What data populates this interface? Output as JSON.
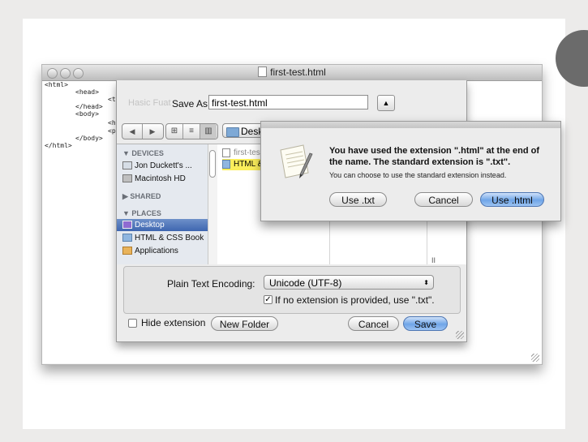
{
  "editor": {
    "title": "first-test.html",
    "code_lines": [
      "<html>",
      "<head>",
      "<t",
      "</head>",
      "<body>",
      "<h",
      "<p",
      "</body>",
      "</html>"
    ]
  },
  "save_dialog": {
    "faint_label": "Hasic Fuat",
    "save_as_label": "Save As:",
    "filename": "first-test.html",
    "expand_symbol": "▲",
    "nav_back": "◀",
    "nav_forward": "▶",
    "view_icon": "⊞",
    "view_list": "≡",
    "view_columns": "▥",
    "location": "Desktop",
    "sidebar": {
      "devices_header": "▼ DEVICES",
      "devices": [
        "Jon Duckett's ...",
        "Macintosh HD"
      ],
      "shared_header": "▶ SHARED",
      "places_header": "▼ PLACES",
      "places": [
        "Desktop",
        "HTML & CSS Book",
        "Applications"
      ]
    },
    "files": [
      "first-test.html",
      "HTML & CSS"
    ],
    "column_handle": "II",
    "encoding_label": "Plain Text Encoding:",
    "encoding_value": "Unicode (UTF-8)",
    "encoding_arrows": "⬍",
    "ext_checkbox_checked": "✓",
    "ext_checkbox_label": "If no extension is provided, use \".txt\".",
    "hide_extension_label": "Hide extension",
    "new_folder": "New Folder",
    "cancel": "Cancel",
    "save": "Save"
  },
  "alert": {
    "title": "You have used the extension \".html\" at the end of the name. The standard extension is \".txt\".",
    "message": "You can choose to use the standard extension instead.",
    "use_txt": "Use .txt",
    "cancel": "Cancel",
    "use_html": "Use .html"
  }
}
